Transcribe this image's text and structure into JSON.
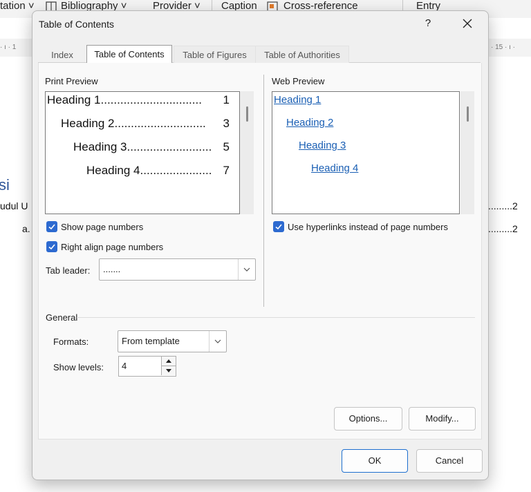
{
  "background": {
    "ribbon": [
      "tation ˅",
      "Bibliography ˅",
      "Provider ˅",
      "Caption",
      "Cross-reference",
      "Entry"
    ],
    "ruler_left": "· ı · 1",
    "ruler_right": "· 15 · ı ·",
    "doc_heading_fragment": "si",
    "doc_line1_left": "udul U",
    "doc_line1_right": ".........2",
    "doc_line2_left": "a.",
    "doc_line2_right": ".........2"
  },
  "dialog": {
    "title": "Table of Contents",
    "help": "?",
    "tabs": [
      {
        "label": "Index",
        "active": false
      },
      {
        "label": "Table of Contents",
        "active": true
      },
      {
        "label": "Table of Figures",
        "active": false
      },
      {
        "label": "Table of Authorities",
        "active": false
      }
    ],
    "print_preview": {
      "label": "Print Preview",
      "lines": [
        {
          "text": "Heading 1",
          "leader": "...............................",
          "page": "1"
        },
        {
          "text": "Heading 2",
          "leader": "............................",
          "page": "3"
        },
        {
          "text": "Heading 3",
          "leader": "..........................",
          "page": "5"
        },
        {
          "text": "Heading 4",
          "leader": "......................",
          "page": "7"
        }
      ]
    },
    "web_preview": {
      "label": "Web Preview",
      "links": [
        "Heading 1",
        "Heading 2",
        "Heading 3",
        "Heading 4"
      ]
    },
    "show_page_numbers": {
      "label": "Show page numbers",
      "checked": true
    },
    "right_align": {
      "label": "Right align page numbers",
      "checked": true
    },
    "use_hyperlinks": {
      "label": "Use hyperlinks instead of page numbers",
      "checked": true
    },
    "tab_leader": {
      "label": "Tab leader:",
      "value": "......."
    },
    "general": {
      "label": "General",
      "formats_label": "Formats:",
      "formats_value": "From template",
      "levels_label": "Show levels:",
      "levels_value": "4"
    },
    "options_button": "Options...",
    "modify_button": "Modify...",
    "ok_button": "OK",
    "cancel_button": "Cancel",
    "accent_color": "#2d6ad0",
    "link_color": "#1a5fb4"
  }
}
